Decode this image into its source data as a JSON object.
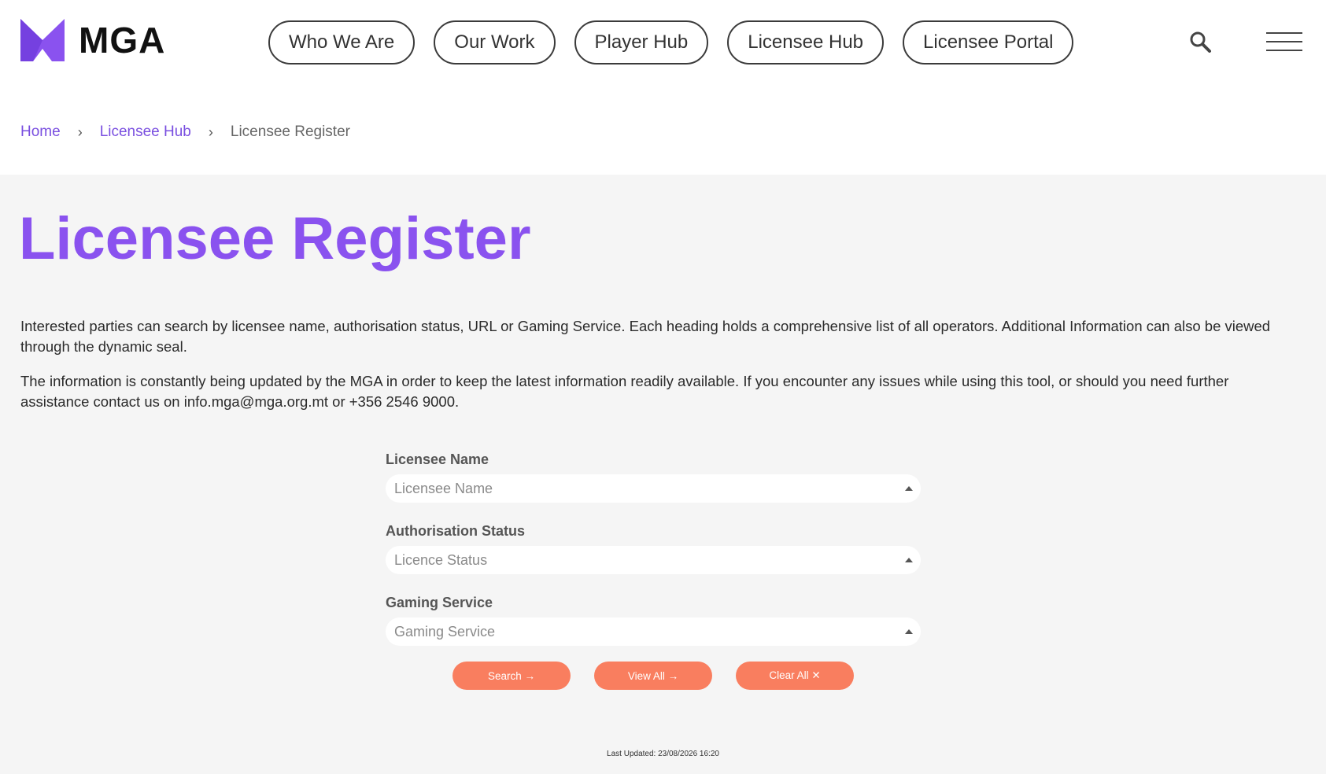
{
  "header": {
    "logo_text": "MGA",
    "nav": [
      {
        "label": "Who We Are"
      },
      {
        "label": "Our Work"
      },
      {
        "label": "Player Hub"
      },
      {
        "label": "Licensee Hub"
      },
      {
        "label": "Licensee Portal"
      }
    ],
    "icons": {
      "search": "search-icon",
      "menu": "hamburger-menu-icon"
    },
    "brand_color": "#8a52ef"
  },
  "breadcrumb": {
    "home": "Home",
    "hub": "Licensee Hub",
    "current": "Licensee Register",
    "separator": "›"
  },
  "main": {
    "title": "Licensee Register",
    "intro_1": "Interested parties can search by licensee name, authorisation status, URL or Gaming Service. Each heading holds a comprehensive list of all operators. Additional Information can also be viewed through the dynamic seal.",
    "intro_2": "The information is constantly being updated by the MGA in order to keep the latest information readily available. If you encounter any issues while using this tool, or should you need further assistance contact us on info.mga@mga.org.mt or +356 2546 9000."
  },
  "form": {
    "fields": [
      {
        "label": "Licensee Name",
        "placeholder": "Licensee Name"
      },
      {
        "label": "Authorisation Status",
        "placeholder": "Licence Status"
      },
      {
        "label": "Gaming Service",
        "placeholder": "Gaming Service"
      }
    ],
    "buttons": {
      "search": "Search →",
      "view_all": "View All →",
      "clear_all": "Clear All ✕"
    },
    "button_color": "#f97e5f"
  },
  "footer": {
    "last_updated": "Last Updated: 23/08/2026 16:20"
  }
}
